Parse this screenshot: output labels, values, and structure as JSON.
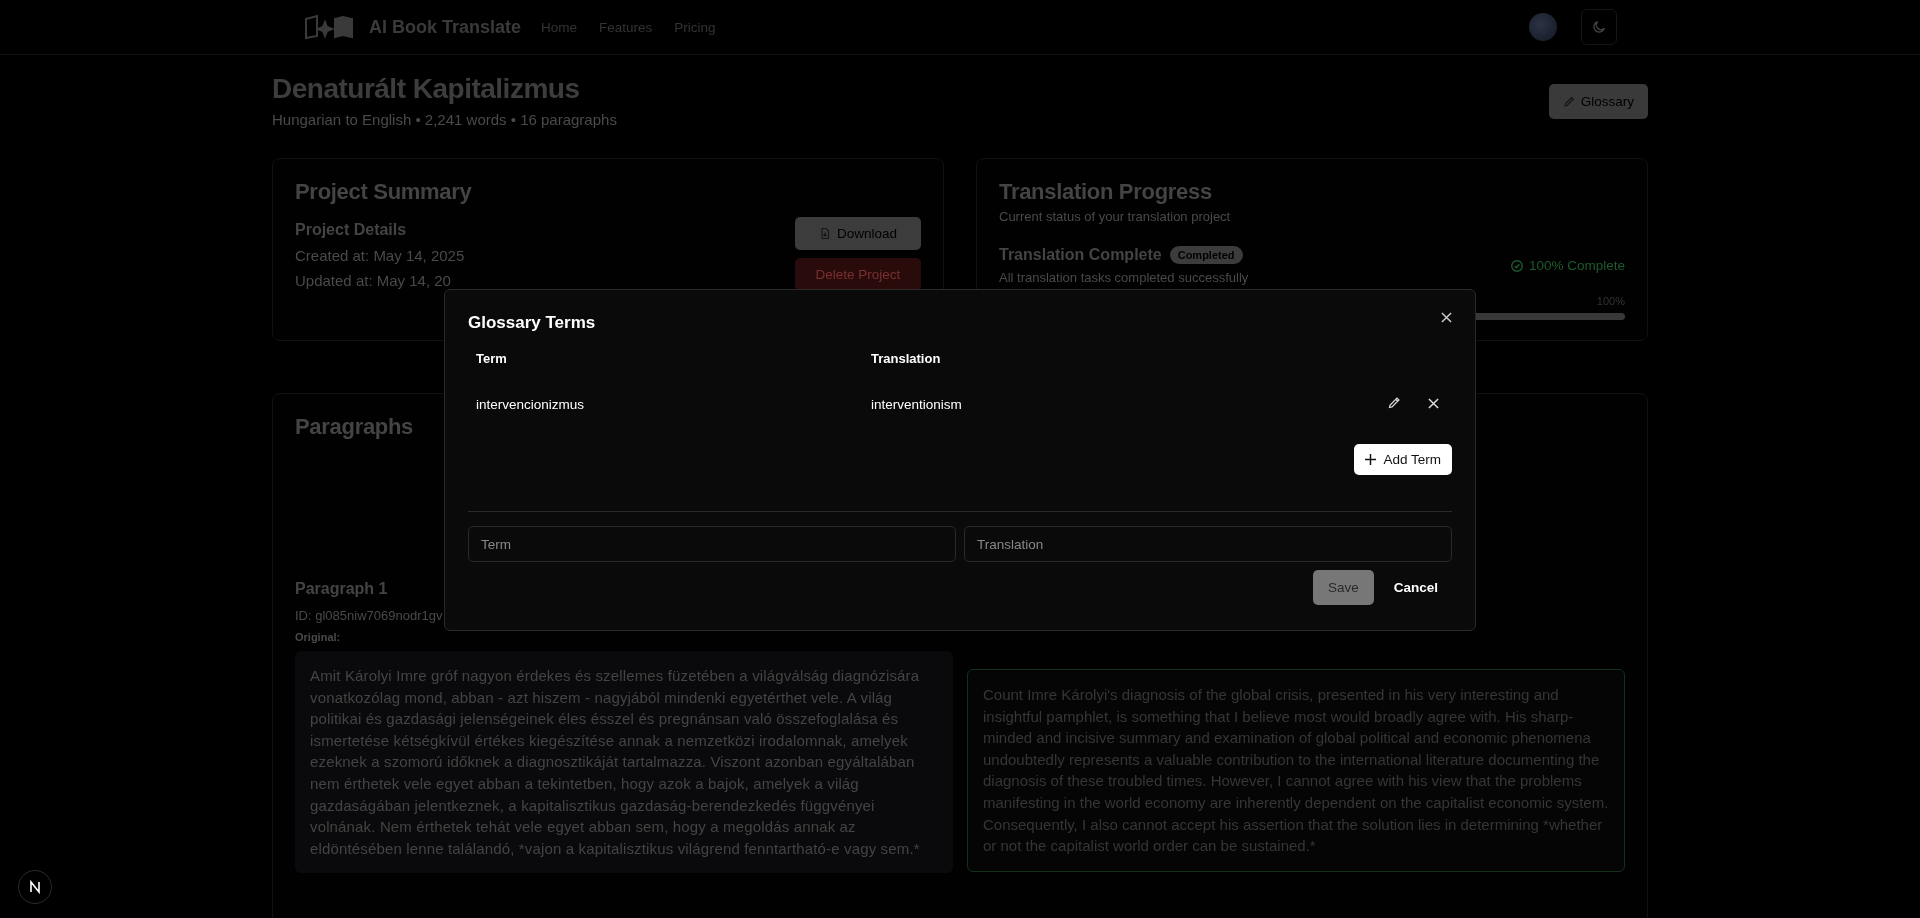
{
  "header": {
    "brand": "AI Book Translate",
    "nav": [
      {
        "label": "Home"
      },
      {
        "label": "Features"
      },
      {
        "label": "Pricing"
      }
    ]
  },
  "project": {
    "title": "Denaturált Kapitalizmus",
    "subtitle": "Hungarian to English • 2,241 words • 16 paragraphs",
    "glossary_button": "Glossary"
  },
  "summary": {
    "title": "Project Summary",
    "details_title": "Project Details",
    "created": "Created at: May 14, 2025",
    "updated": "Updated at: May 14, 20",
    "download": "Download",
    "delete": "Delete Project"
  },
  "progress": {
    "title": "Translation Progress",
    "subtitle": "Current status of your translation project",
    "status": "Translation Complete",
    "badge": "Completed",
    "description": "All translation tasks completed successfully",
    "complete_label": "100% Complete",
    "percent": "100%",
    "level": 1.0
  },
  "paragraphs": {
    "title": "Paragraphs",
    "items": [
      {
        "title": "Paragraph 1",
        "id": "ID: gl085niw7069nodr1gv",
        "original_label": "Original:",
        "original": "Amit Károlyi Imre gróf nagyon érdekes és szellemes füzetében a világválság diagnózisára vonatkozólag mond, abban - azt hiszem - nagyjából mindenki egyetérthet vele. A világ politikai és gazdasági jelenségeinek éles ésszel és pregnánsan való összefoglalása és ismertetése kétségkívül értékes kiegészítése annak a nemzetközi irodalomnak, amelyek ezeknek a szomorú időknek a diagnosztikáját tartalmazza. Viszont azonban egyáltalában nem érthetek vele egyet abban a tekintetben, hogy azok a bajok, amelyek a világ gazdaságában jelentkeznek, a kapitalisztikus gazdaság-berendezkedés függvényei volnának. Nem érthetek tehát vele egyet abban sem, hogy a megoldás annak az eldöntésében lenne találandó, *vajon a kapitalisztikus világrend fenntartható-e vagy sem.*",
        "translation": "Count Imre Károlyi's diagnosis of the global crisis, presented in his very interesting and insightful pamphlet, is something that I believe most would broadly agree with. His sharp-minded and incisive summary and examination of global political and economic phenomena undoubtedly represents a valuable contribution to the international literature documenting the diagnosis of these troubled times. However, I cannot agree with his view that the problems manifesting in the world economy are inherently dependent on the capitalist economic system. Consequently, I also cannot accept his assertion that the solution lies in determining *whether or not the capitalist world order can be sustained.*"
      }
    ]
  },
  "glossary_dialog": {
    "title": "Glossary Terms",
    "columns": [
      "Term",
      "Translation"
    ],
    "rows": [
      {
        "term": "intervencionizmus",
        "translation": "interventionism"
      }
    ],
    "add_button": "Add Term",
    "term_input": {
      "placeholder": "Term"
    },
    "translation_input": {
      "placeholder": "Translation"
    },
    "save_button": "Save",
    "cancel_button": "Cancel"
  }
}
